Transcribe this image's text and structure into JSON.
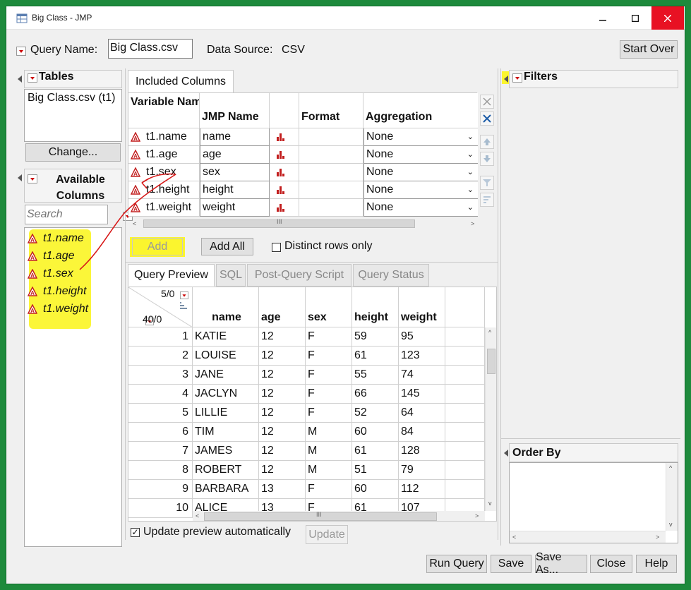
{
  "window": {
    "title": "Big Class - JMP"
  },
  "query": {
    "name_label": "Query Name:",
    "name_value": "Big Class.csv",
    "source_label": "Data Source:",
    "source_value": "CSV",
    "start_over": "Start Over"
  },
  "tables": {
    "header": "Tables",
    "items": [
      "Big Class.csv (t1)"
    ],
    "change_button": "Change..."
  },
  "available": {
    "header": "Available Columns",
    "search_placeholder": "Search",
    "items": [
      "t1.name",
      "t1.age",
      "t1.sex",
      "t1.height",
      "t1.weight"
    ]
  },
  "included": {
    "tab_label": "Included Columns",
    "headers": {
      "variable": "Variable Name",
      "jmp": "JMP Name",
      "format": "Format",
      "aggregation": "Aggregation"
    },
    "rows": [
      {
        "variable": "t1.name",
        "jmp": "name",
        "aggregation": "None"
      },
      {
        "variable": "t1.age",
        "jmp": "age",
        "aggregation": "None"
      },
      {
        "variable": "t1.sex",
        "jmp": "sex",
        "aggregation": "None"
      },
      {
        "variable": "t1.height",
        "jmp": "height",
        "aggregation": "None"
      },
      {
        "variable": "t1.weight",
        "jmp": "weight",
        "aggregation": "None"
      }
    ],
    "add_button": "Add",
    "add_all_button": "Add All",
    "distinct_label": "Distinct rows only"
  },
  "preview": {
    "tabs": [
      "Query Preview",
      "SQL",
      "Post-Query Script",
      "Query Status"
    ],
    "cols_count": "5/0",
    "rows_count": "40/0",
    "columns": [
      "name",
      "age",
      "sex",
      "height",
      "weight"
    ],
    "rows": [
      [
        "1",
        "KATIE",
        "12",
        "F",
        "59",
        "95"
      ],
      [
        "2",
        "LOUISE",
        "12",
        "F",
        "61",
        "123"
      ],
      [
        "3",
        "JANE",
        "12",
        "F",
        "55",
        "74"
      ],
      [
        "4",
        "JACLYN",
        "12",
        "F",
        "66",
        "145"
      ],
      [
        "5",
        "LILLIE",
        "12",
        "F",
        "52",
        "64"
      ],
      [
        "6",
        "TIM",
        "12",
        "M",
        "60",
        "84"
      ],
      [
        "7",
        "JAMES",
        "12",
        "M",
        "61",
        "128"
      ],
      [
        "8",
        "ROBERT",
        "12",
        "M",
        "51",
        "79"
      ],
      [
        "9",
        "BARBARA",
        "13",
        "F",
        "60",
        "112"
      ],
      [
        "10",
        "ALICE",
        "13",
        "F",
        "61",
        "107"
      ]
    ],
    "update_auto_label": "Update preview automatically",
    "update_button": "Update"
  },
  "filters": {
    "header": "Filters"
  },
  "order_by": {
    "header": "Order By"
  },
  "footer": {
    "run_query": "Run Query",
    "save": "Save",
    "save_as": "Save As...",
    "close": "Close",
    "help": "Help"
  },
  "colors": {
    "frame": "#1e8a3c",
    "highlight": "#fbf52e",
    "close_red": "#e81123",
    "annotation": "#d81b1b"
  }
}
